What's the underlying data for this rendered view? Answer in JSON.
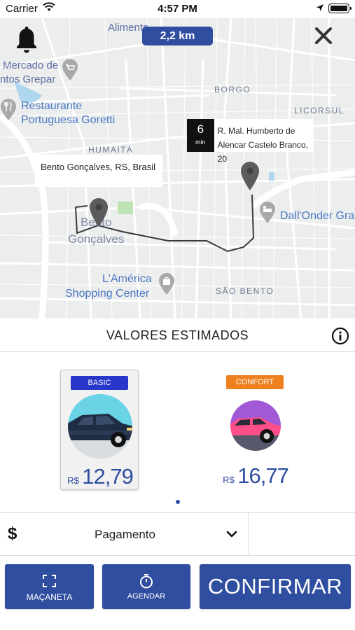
{
  "status_bar": {
    "carrier": "Carrier",
    "time": "4:57 PM"
  },
  "map": {
    "distance": "2,2 km",
    "labels": {
      "alimento": "Alimento",
      "mercado_line1": "Mercado de",
      "mercado_line2": "ntos Grepar",
      "restaurante_line1": "Restaurante",
      "restaurante_line2": "Portuguesa Goretti",
      "borgo": "BORGO",
      "licorsul": "LICORSUL",
      "humaita": "HUMAITÁ",
      "dallonder": "Dall'Onder Gra",
      "city_line1": "Bento",
      "city_line2": "Gonçalves",
      "shopping_line1": "L'América",
      "shopping_line2": "Shopping Center",
      "sao_bento": "SÃO BENTO"
    },
    "origin": "Bento Gonçalves, RS, Brasil",
    "eta_value": "6",
    "eta_unit": "min",
    "destination_line1": "R. Mal. Humberto de",
    "destination_line2": "Alencar Castelo Branco, 20"
  },
  "estimates": {
    "title": "VALORES ESTIMADOS"
  },
  "rides": [
    {
      "badge": "BASIC",
      "currency": "R$",
      "price": "12,79",
      "badge_color": "#2836c9",
      "selected": true
    },
    {
      "badge": "CONFORT",
      "currency": "R$",
      "price": "16,77",
      "badge_color": "#ee8020",
      "selected": false
    }
  ],
  "payment": {
    "symbol": "$",
    "label": "Pagamento"
  },
  "actions": {
    "macaneta": "MAÇANETA",
    "agendar": "AGENDAR",
    "confirm": "CONFIRMAR"
  },
  "colors": {
    "primary": "#2f4ea0",
    "route": "#3a3a3a",
    "map_bg": "#eceded"
  }
}
